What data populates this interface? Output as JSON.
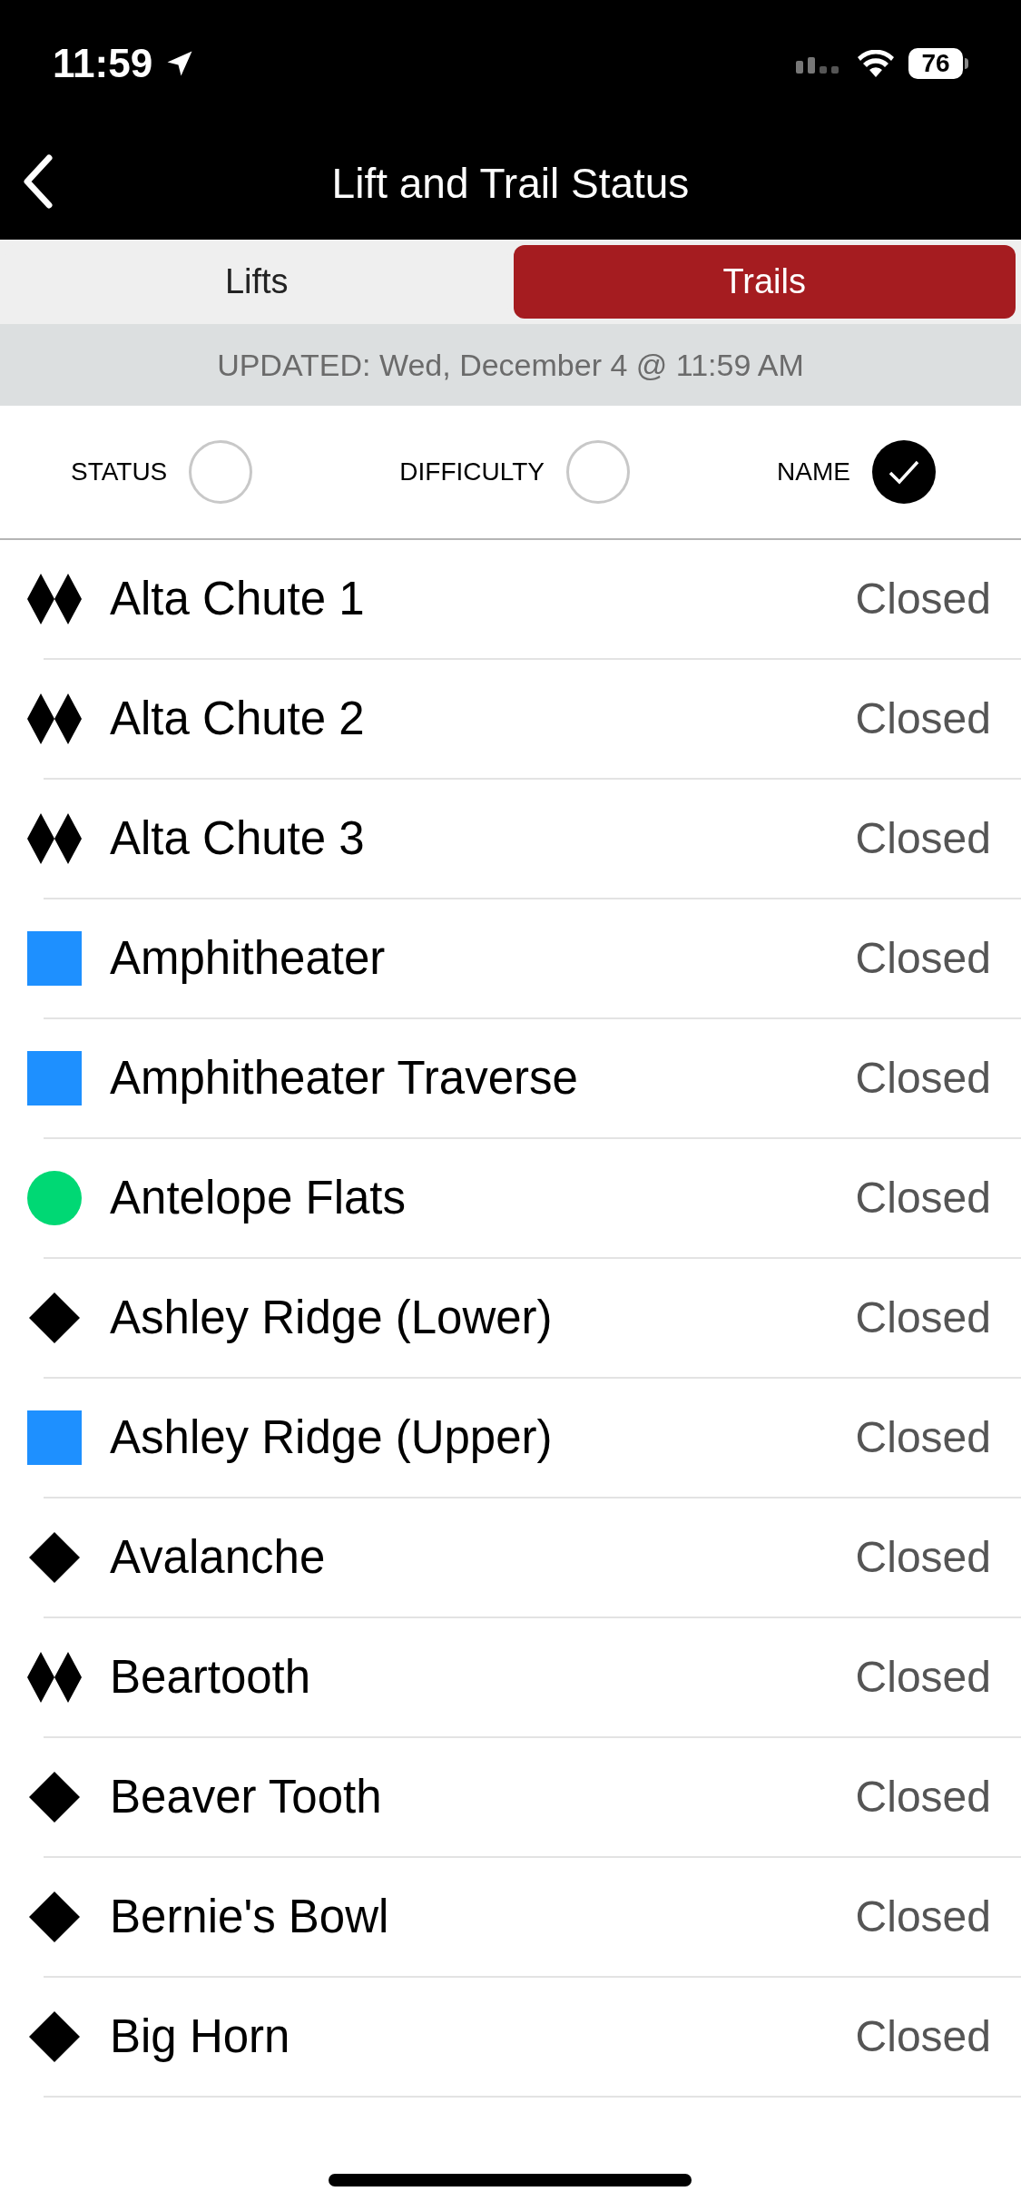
{
  "status_bar": {
    "time": "11:59",
    "battery": "76"
  },
  "header": {
    "title": "Lift and Trail Status"
  },
  "tabs": [
    {
      "label": "Lifts",
      "selected": false
    },
    {
      "label": "Trails",
      "selected": true
    }
  ],
  "updated": "UPDATED: Wed, December 4 @ 11:59 AM",
  "sort_options": [
    {
      "label": "STATUS",
      "checked": false
    },
    {
      "label": "DIFFICULTY",
      "checked": false
    },
    {
      "label": "NAME",
      "checked": true
    }
  ],
  "trails": [
    {
      "name": "Alta Chute 1",
      "kind": "double-black",
      "status": "Closed"
    },
    {
      "name": "Alta Chute 2",
      "kind": "double-black",
      "status": "Closed"
    },
    {
      "name": "Alta Chute 3",
      "kind": "double-black",
      "status": "Closed"
    },
    {
      "name": "Amphitheater",
      "kind": "blue",
      "status": "Closed"
    },
    {
      "name": "Amphitheater Traverse",
      "kind": "blue",
      "status": "Closed"
    },
    {
      "name": "Antelope Flats",
      "kind": "green",
      "status": "Closed"
    },
    {
      "name": "Ashley Ridge (Lower)",
      "kind": "black",
      "status": "Closed"
    },
    {
      "name": "Ashley Ridge (Upper)",
      "kind": "blue",
      "status": "Closed"
    },
    {
      "name": "Avalanche",
      "kind": "black",
      "status": "Closed"
    },
    {
      "name": "Beartooth",
      "kind": "double-black",
      "status": "Closed"
    },
    {
      "name": "Beaver Tooth",
      "kind": "black",
      "status": "Closed"
    },
    {
      "name": "Bernie's Bowl",
      "kind": "black",
      "status": "Closed"
    },
    {
      "name": "Big Horn",
      "kind": "black",
      "status": "Closed"
    }
  ]
}
